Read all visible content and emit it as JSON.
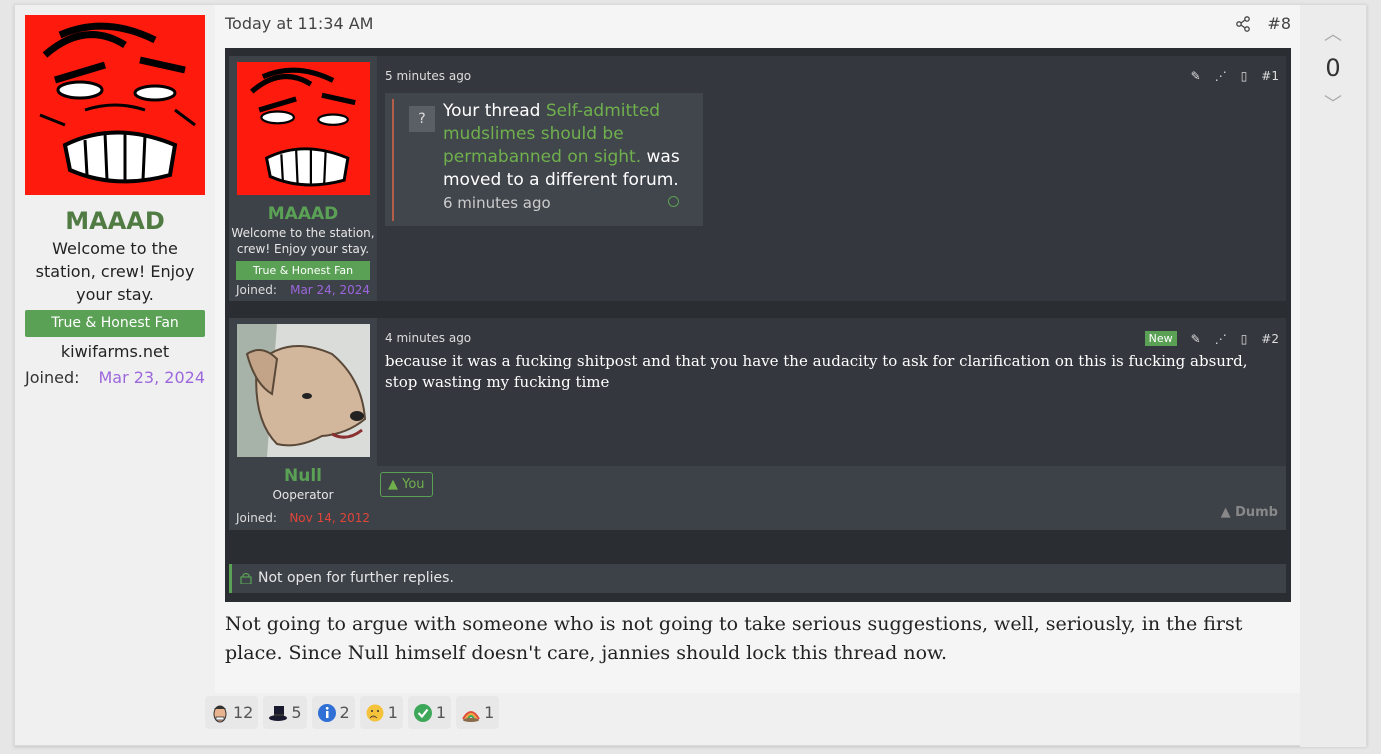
{
  "author": {
    "name": "MAAAD",
    "title": "Welcome to the station, crew! Enjoy your stay.",
    "banner": "True & Honest Fan",
    "site": "kiwifarms.net",
    "joined_label": "Joined:",
    "joined_date": "Mar 23, 2024"
  },
  "post": {
    "timestamp": "Today at 11:34 AM",
    "number": "#8",
    "body": "Not going to argue with someone who is not going to take serious suggestions, well, seriously, in the first place. Since Null himself doesn't care, jannies should lock this thread now."
  },
  "screenshot": {
    "msg1": {
      "name": "MAAAD",
      "title": "Welcome to the station, crew! Enjoy your stay.",
      "banner": "True & Honest Fan",
      "joined_label": "Joined:",
      "joined_date": "Mar 24, 2024",
      "time": "5 minutes ago",
      "number": "#1",
      "alert_prefix": "Your thread",
      "alert_link": "Self-admitted mudslimes should be permabanned on sight.",
      "alert_suffix": "was moved to a different forum.",
      "alert_time": "6 minutes ago"
    },
    "msg2": {
      "name": "Null",
      "title": "Ooperator",
      "joined_label": "Joined:",
      "joined_date": "Nov 14, 2012",
      "time": "4 minutes ago",
      "badge": "New",
      "number": "#2",
      "text": "because it was a fucking shitpost and that you have the audacity to ask for clarification on this is fucking absurd, stop wasting my fucking time",
      "you_label": "You",
      "dumb_label": "Dumb"
    },
    "locked_text": "Not open for further replies."
  },
  "votes": {
    "count": "0"
  },
  "reactions": [
    {
      "icon": "face-icon",
      "count": "12"
    },
    {
      "icon": "top-hat-icon",
      "count": "5"
    },
    {
      "icon": "info-icon",
      "count": "2"
    },
    {
      "icon": "thinking-icon",
      "count": "1"
    },
    {
      "icon": "check-icon",
      "count": "1"
    },
    {
      "icon": "rainbow-icon",
      "count": "1"
    }
  ],
  "colors": {
    "accent": "#5aa055",
    "purple": "#9c67dc",
    "red": "#e0453a"
  }
}
